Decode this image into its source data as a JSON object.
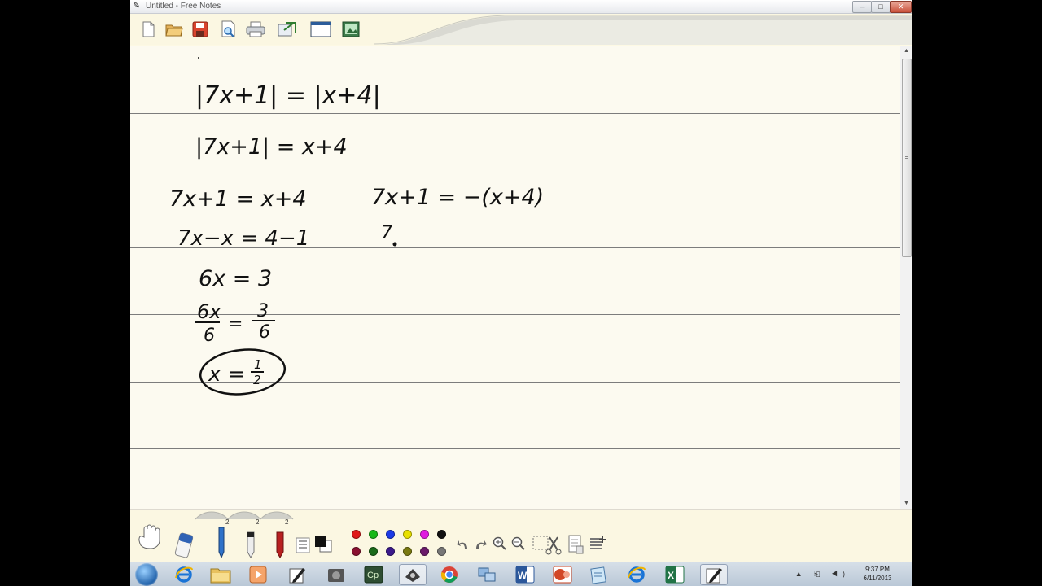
{
  "window": {
    "title": "Untitled - Free Notes",
    "minimize_glyph": "‒",
    "maximize_glyph": "□",
    "close_glyph": "✕"
  },
  "toolbar": {
    "buttons": [
      "new-page-icon",
      "open-folder-icon",
      "save-disk-icon",
      "print-preview-icon",
      "print-icon",
      "export-icon",
      "fullscreen-window-icon",
      "insert-picture-icon"
    ]
  },
  "notes": {
    "line1": "|7x+1| = |x+4|",
    "line2": "|7x+1| = x+4",
    "case1": [
      "7x+1 = x+4",
      "7x−x = 4−1",
      "6x = 3",
      "6x/6 = 3/6",
      "x = 1/2"
    ],
    "case2": [
      "7x+1 = −(x+4)",
      "7"
    ]
  },
  "bottom_tools": {
    "size_labels": [
      "2",
      "2",
      "2"
    ],
    "colors": [
      "#e01818",
      "#18b818",
      "#1c3ae6",
      "#e8e000",
      "#e018e0",
      "#111111",
      "#8a1030",
      "#1a6a1a",
      "#3b1a8c",
      "#7a7a10",
      "#6a1a6a",
      "#777777"
    ],
    "icons": [
      "hand-pan-icon",
      "eraser-icon",
      "pen-tool-icon",
      "marker-tool-icon",
      "highlighter-tool-icon",
      "line-style-icon",
      "color-box-icon",
      "undo-icon",
      "redo-icon",
      "zoom-in-icon",
      "zoom-out-icon",
      "select-cut-icon",
      "page-icon",
      "insert-page-icon"
    ]
  },
  "taskbar": {
    "apps": [
      "internet-explorer-icon",
      "file-explorer-icon",
      "media-player-icon",
      "free-notes-icon",
      "app-icon",
      "captivate-icon",
      "screen-capture-icon",
      "chrome-icon",
      "network-icon",
      "word-icon",
      "powerpoint-icon",
      "notepad-icon",
      "internet-explorer-icon",
      "excel-icon",
      "free-notes-active-icon"
    ],
    "captivate_text": "Cp",
    "word_text": "W",
    "excel_text": "X",
    "tray_text": "▲ ⎗ ◀)",
    "time": "9:37 PM",
    "date": "6/11/2013"
  }
}
